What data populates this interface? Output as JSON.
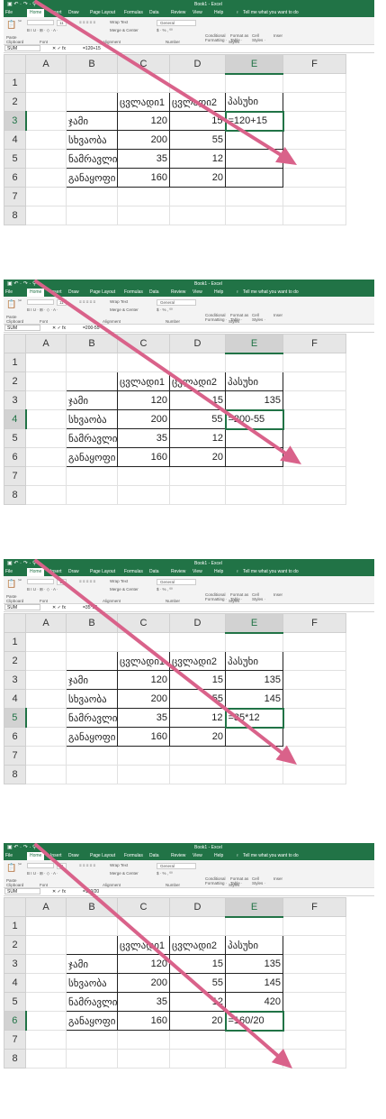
{
  "excel": {
    "quick_access": "▣ ↶ · ↷ ·  ⚲",
    "window_title": "Book1 - Excel",
    "menu": [
      "File",
      "Home",
      "Insert",
      "Draw",
      "Page Layout",
      "Formulas",
      "Data",
      "Review",
      "View",
      "Help"
    ],
    "tell_me": "Tell me what you want to do",
    "ribbon": {
      "paste": "Paste",
      "font_controls": "B  I  U  ·  ⊞ ·  ◇ ·  A ·",
      "font_size": "11",
      "wrap_text": "Wrap Text",
      "merge": "Merge & Center",
      "number_format": "General",
      "number_controls": "$ ·  %  ,   ⁰⁰",
      "conditional": "Conditional Formatting ·",
      "format_table": "Format as Table ·",
      "cell_styles": "Cell Styles ·",
      "insert": "Inser",
      "groups": [
        "Clipboard",
        "Font",
        "Alignment",
        "Number",
        "Styles"
      ]
    },
    "name_box": "SUM",
    "formula_icons": "✕   ✓   fx"
  },
  "columns": [
    "A",
    "B",
    "C",
    "D",
    "E",
    "F"
  ],
  "rows": [
    "1",
    "2",
    "3",
    "4",
    "5",
    "6",
    "7",
    "8"
  ],
  "table": {
    "headers": [
      "ცვლადი1",
      "ცვლადი2",
      "პასუხი"
    ],
    "row_labels": [
      "ჯამი",
      "სხვაობა",
      "ნამრავლი",
      "განაყოფი"
    ],
    "var1": [
      "120",
      "200",
      "35",
      "160"
    ],
    "var2": [
      "15",
      "55",
      "12",
      "20"
    ]
  },
  "panels": [
    {
      "formula": "=120+15",
      "answers": [
        "=120+15",
        "",
        "",
        ""
      ],
      "active_row": 3,
      "sel_index": 0
    },
    {
      "formula": "=200-55",
      "answers": [
        "135",
        "=200-55",
        "",
        ""
      ],
      "active_row": 4,
      "sel_index": 1
    },
    {
      "formula": "=35*12",
      "answers": [
        "135",
        "145",
        "=35*12",
        ""
      ],
      "active_row": 5,
      "sel_index": 2
    },
    {
      "formula": "=160/20",
      "answers": [
        "135",
        "145",
        "420",
        "=160/20"
      ],
      "active_row": 6,
      "sel_index": 3
    }
  ],
  "arrow_color": "#d9628a"
}
